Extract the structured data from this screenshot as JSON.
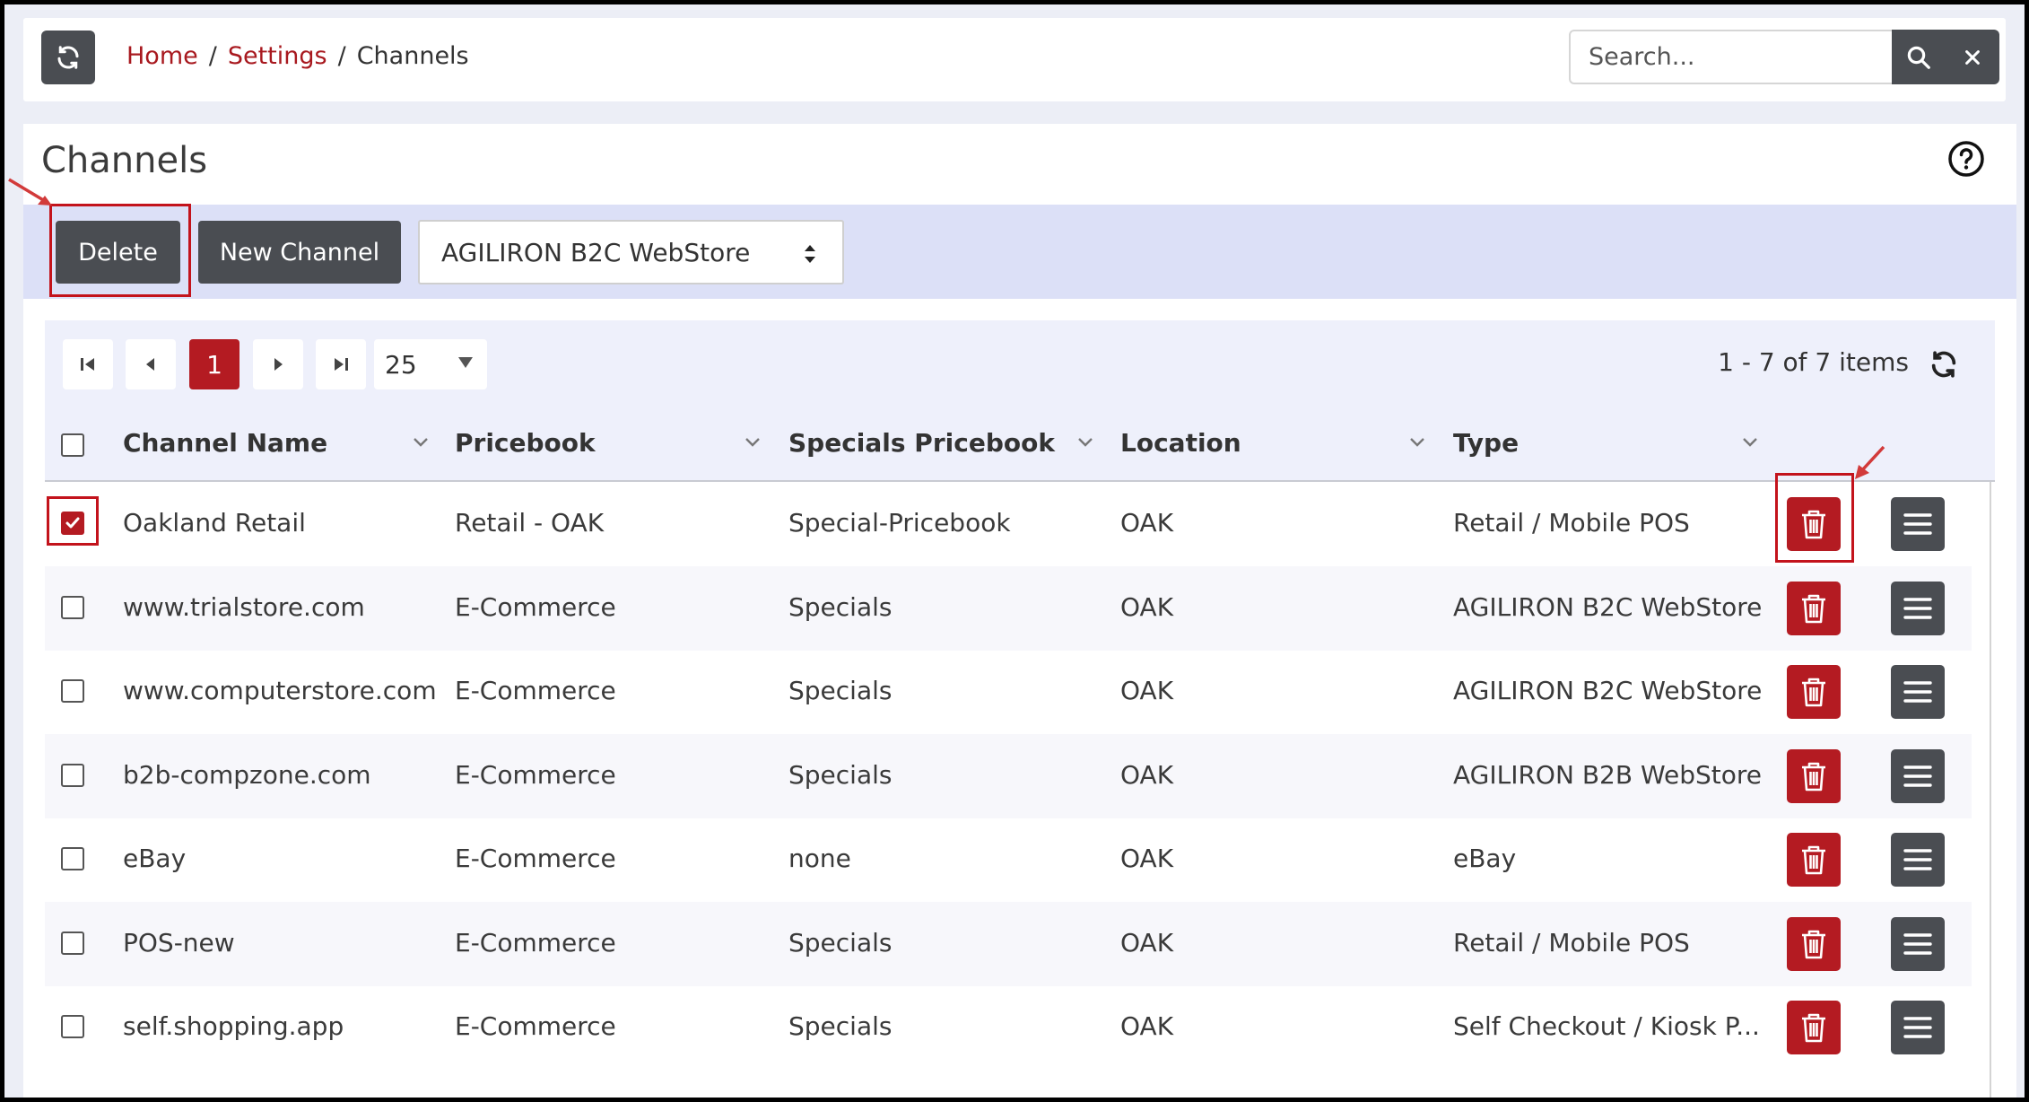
{
  "breadcrumb": {
    "home": "Home",
    "settings": "Settings",
    "current": "Channels",
    "sep": "/"
  },
  "search": {
    "placeholder": "Search..."
  },
  "page": {
    "title": "Channels"
  },
  "toolbar": {
    "delete_label": "Delete",
    "new_channel_label": "New Channel",
    "channel_type_selected": "AGILIRON B2C WebStore"
  },
  "pager": {
    "current_page": "1",
    "page_size": "25",
    "items_info": "1 - 7 of 7 items"
  },
  "columns": [
    "Channel Name",
    "Pricebook",
    "Specials Pricebook",
    "Location",
    "Type"
  ],
  "rows": [
    {
      "name": "Oakland Retail",
      "pricebook": "Retail - OAK",
      "specials": "Special-Pricebook",
      "location": "OAK",
      "type": "Retail / Mobile POS",
      "checked": true
    },
    {
      "name": "www.trialstore.com",
      "pricebook": "E-Commerce",
      "specials": "Specials",
      "location": "OAK",
      "type": "AGILIRON B2C WebStore",
      "checked": false
    },
    {
      "name": "www.computerstore.com",
      "pricebook": "E-Commerce",
      "specials": "Specials",
      "location": "OAK",
      "type": "AGILIRON B2C WebStore",
      "checked": false
    },
    {
      "name": "b2b-compzone.com",
      "pricebook": "E-Commerce",
      "specials": "Specials",
      "location": "OAK",
      "type": "AGILIRON B2B WebStore",
      "checked": false
    },
    {
      "name": "eBay",
      "pricebook": "E-Commerce",
      "specials": "none",
      "location": "OAK",
      "type": "eBay",
      "checked": false
    },
    {
      "name": "POS-new",
      "pricebook": "E-Commerce",
      "specials": "Specials",
      "location": "OAK",
      "type": "Retail / Mobile POS",
      "checked": false
    },
    {
      "name": "self.shopping.app",
      "pricebook": "E-Commerce",
      "specials": "Specials",
      "location": "OAK",
      "type": "Self Checkout / Kiosk P...",
      "checked": false
    }
  ],
  "colors": {
    "accent_red": "#b41b22",
    "dark_button": "#4a4d52",
    "link_red": "#a8191f",
    "toolbar_bg": "#dce0f7"
  }
}
